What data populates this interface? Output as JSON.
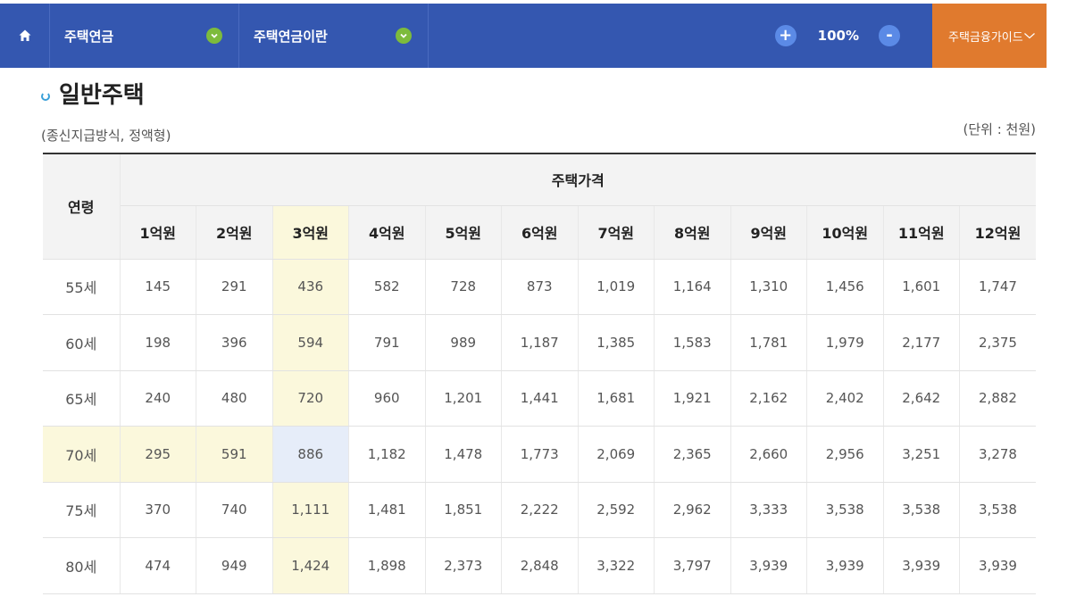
{
  "nav": {
    "breadcrumb": [
      "주택연금",
      "주택연금이란"
    ],
    "zoom_in": "+",
    "zoom_level": "100%",
    "zoom_out": "-",
    "guide_label": "주택금융가이드"
  },
  "section": {
    "title": "일반주택",
    "subtitle": "(종신지급방식, 정액형)",
    "unit": "(단위 : 천원)"
  },
  "table": {
    "age_header": "연령",
    "price_header": "주택가격",
    "price_columns": [
      "1억원",
      "2억원",
      "3억원",
      "4억원",
      "5억원",
      "6억원",
      "7억원",
      "8억원",
      "9억원",
      "10억원",
      "11억원",
      "12억원"
    ],
    "rows": [
      {
        "age": "55세",
        "values": [
          "145",
          "291",
          "436",
          "582",
          "728",
          "873",
          "1,019",
          "1,164",
          "1,310",
          "1,456",
          "1,601",
          "1,747"
        ]
      },
      {
        "age": "60세",
        "values": [
          "198",
          "396",
          "594",
          "791",
          "989",
          "1,187",
          "1,385",
          "1,583",
          "1,781",
          "1,979",
          "2,177",
          "2,375"
        ]
      },
      {
        "age": "65세",
        "values": [
          "240",
          "480",
          "720",
          "960",
          "1,201",
          "1,441",
          "1,681",
          "1,921",
          "2,162",
          "2,402",
          "2,642",
          "2,882"
        ]
      },
      {
        "age": "70세",
        "values": [
          "295",
          "591",
          "886",
          "1,182",
          "1,478",
          "1,773",
          "2,069",
          "2,365",
          "2,660",
          "2,956",
          "3,251",
          "3,278"
        ]
      },
      {
        "age": "75세",
        "values": [
          "370",
          "740",
          "1,111",
          "1,481",
          "1,851",
          "2,222",
          "2,592",
          "2,962",
          "3,333",
          "3,538",
          "3,538",
          "3,538"
        ]
      },
      {
        "age": "80세",
        "values": [
          "474",
          "949",
          "1,424",
          "1,898",
          "2,373",
          "2,848",
          "3,322",
          "3,797",
          "3,939",
          "3,939",
          "3,939",
          "3,939"
        ]
      }
    ],
    "highlight": {
      "column_index": 2,
      "row_index": 3
    },
    "colors": {
      "highlight": "#fbf8dc",
      "intersection": "#e6edf9"
    }
  },
  "icons": {
    "home": "home-icon",
    "dropdown": "chevron-down-icon",
    "guide_toggle": "chevron-down-icon"
  },
  "colors": {
    "nav_bg": "#3457b0",
    "guide_bg": "#e07a2e",
    "dot_green": "#7dbb3c",
    "zoom_btn": "#5b8ae6"
  }
}
